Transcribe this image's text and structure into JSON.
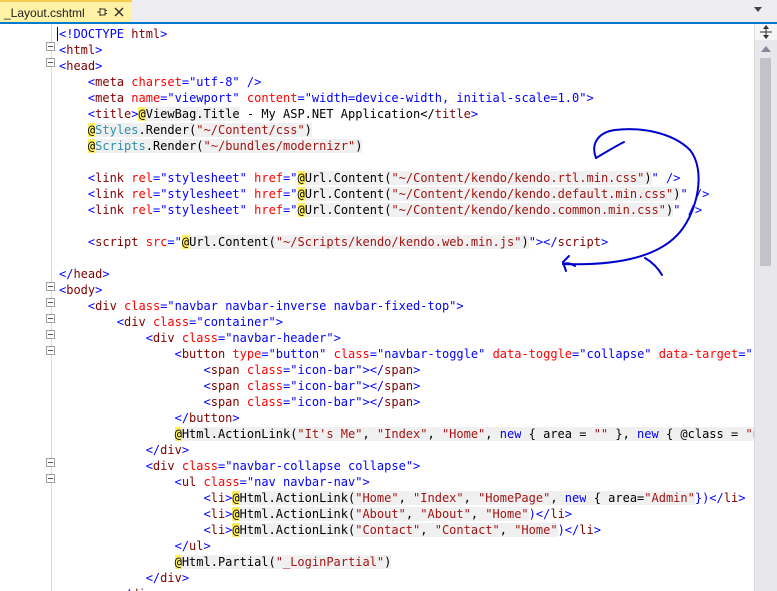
{
  "tab": {
    "title": "_Layout.cshtml",
    "pin_icon": "pin-icon",
    "close_icon": "close-icon"
  },
  "colors": {
    "tab_active": "#fff1a6",
    "tab_border": "#f5cc4e",
    "accent": "#007acc",
    "razor_highlight": "#ffee62",
    "tag": "#800000",
    "attribute": "#ff0000",
    "value": "#0000ff",
    "string": "#a31515",
    "ink": "#0000cc"
  },
  "code": {
    "l1_a": "<!DOCTYPE ",
    "l1_b": "html",
    "l1_c": ">",
    "l2_a": "<",
    "l2_b": "html",
    "l2_c": ">",
    "l3_a": "<",
    "l3_b": "head",
    "l3_c": ">",
    "l4": [
      "    <",
      "meta",
      " ",
      "charset",
      "=",
      "\"utf-8\"",
      " />"
    ],
    "l5": [
      "    <",
      "meta",
      " ",
      "name",
      "=",
      "\"viewport\"",
      " ",
      "content",
      "=",
      "\"width=device-width, initial-scale=1.0\"",
      ">"
    ],
    "l6": [
      "    <",
      "title",
      ">",
      "@",
      "ViewBag.Title",
      " - My ASP.NET Application</",
      "title",
      ">"
    ],
    "l7": [
      "    ",
      "@",
      "Styles",
      ".Render(",
      "\"~/Content/css\"",
      ")"
    ],
    "l8": [
      "    ",
      "@",
      "Scripts",
      ".Render(",
      "\"~/bundles/modernizr\"",
      ")"
    ],
    "l10": [
      "    <",
      "link",
      " ",
      "rel",
      "=",
      "\"stylesheet\"",
      " ",
      "href",
      "=",
      "\"",
      "@",
      "Url.Content(",
      "\"~/Content/kendo/kendo.rtl.min.css\"",
      ")",
      "\"",
      " />"
    ],
    "l11": [
      "    <",
      "link",
      " ",
      "rel",
      "=",
      "\"stylesheet\"",
      " ",
      "href",
      "=",
      "\"",
      "@",
      "Url.Content(",
      "\"~/Content/kendo/kendo.default.min.css\"",
      ")",
      "\"",
      " />"
    ],
    "l12": [
      "    <",
      "link",
      " ",
      "rel",
      "=",
      "\"stylesheet\"",
      " ",
      "href",
      "=",
      "\"",
      "@",
      "Url.Content(",
      "\"~/Content/kendo/kendo.common.min.css\"",
      ")",
      "\"",
      " />"
    ],
    "l14": [
      "    <",
      "script",
      " ",
      "src",
      "=",
      "\"",
      "@",
      "Url.Content(",
      "\"~/Scripts/kendo/kendo.web.min.js\"",
      ")",
      "\"",
      "></",
      "script",
      ">"
    ],
    "l16": [
      "</",
      "head",
      ">"
    ],
    "l17": [
      "<",
      "body",
      ">"
    ],
    "l18": [
      "    <",
      "div",
      " ",
      "class",
      "=",
      "\"navbar navbar-inverse navbar-fixed-top\"",
      ">"
    ],
    "l19": [
      "        <",
      "div",
      " ",
      "class",
      "=",
      "\"container\"",
      ">"
    ],
    "l20": [
      "            <",
      "div",
      " ",
      "class",
      "=",
      "\"navbar-header\"",
      ">"
    ],
    "l21": [
      "                <",
      "button",
      " ",
      "type",
      "=",
      "\"button\"",
      " ",
      "class",
      "=",
      "\"navbar-toggle\"",
      " ",
      "data-toggle",
      "=",
      "\"collapse\"",
      " ",
      "data-target",
      "=",
      "\".na"
    ],
    "l22": [
      "                    <",
      "span",
      " ",
      "class",
      "=",
      "\"icon-bar\"",
      "></",
      "span",
      ">"
    ],
    "l23": [
      "                    <",
      "span",
      " ",
      "class",
      "=",
      "\"icon-bar\"",
      "></",
      "span",
      ">"
    ],
    "l24": [
      "                    <",
      "span",
      " ",
      "class",
      "=",
      "\"icon-bar\"",
      "></",
      "span",
      ">"
    ],
    "l25": [
      "                </",
      "button",
      ">"
    ],
    "l26": [
      "                ",
      "@",
      "Html.ActionLink(",
      "\"It's Me\"",
      ", ",
      "\"Index\"",
      ", ",
      "\"Home\"",
      ", ",
      "new",
      " { area = ",
      "\"\"",
      " }, ",
      "new",
      " { @class = ",
      "\"nav"
    ],
    "l27": [
      "            </",
      "div",
      ">"
    ],
    "l28": [
      "            <",
      "div",
      " ",
      "class",
      "=",
      "\"navbar-collapse collapse\"",
      ">"
    ],
    "l29": [
      "                <",
      "ul",
      " ",
      "class",
      "=",
      "\"nav navbar-nav\"",
      ">"
    ],
    "l30": [
      "                    <",
      "li",
      ">",
      "@",
      "Html.ActionLink(",
      "\"Home\"",
      ", ",
      "\"Index\"",
      ", ",
      "\"HomePage\"",
      ", ",
      "new",
      " { area=",
      "\"Admin\"",
      "})</",
      "li",
      ">"
    ],
    "l31": [
      "                    <",
      "li",
      ">",
      "@",
      "Html.ActionLink(",
      "\"About\"",
      ", ",
      "\"About\"",
      ", ",
      "\"Home\"",
      ")</",
      "li",
      ">"
    ],
    "l32": [
      "                    <",
      "li",
      ">",
      "@",
      "Html.ActionLink(",
      "\"Contact\"",
      ", ",
      "\"Contact\"",
      ", ",
      "\"Home\"",
      ")</",
      "li",
      ">"
    ],
    "l33": [
      "                </",
      "ul",
      ">"
    ],
    "l34": [
      "                ",
      "@",
      "Html.Partial(",
      "\"_LoginPartial\"",
      ")"
    ],
    "l35": [
      "            </",
      "div",
      ">"
    ],
    "l36": [
      "        </",
      "div",
      ">"
    ]
  }
}
